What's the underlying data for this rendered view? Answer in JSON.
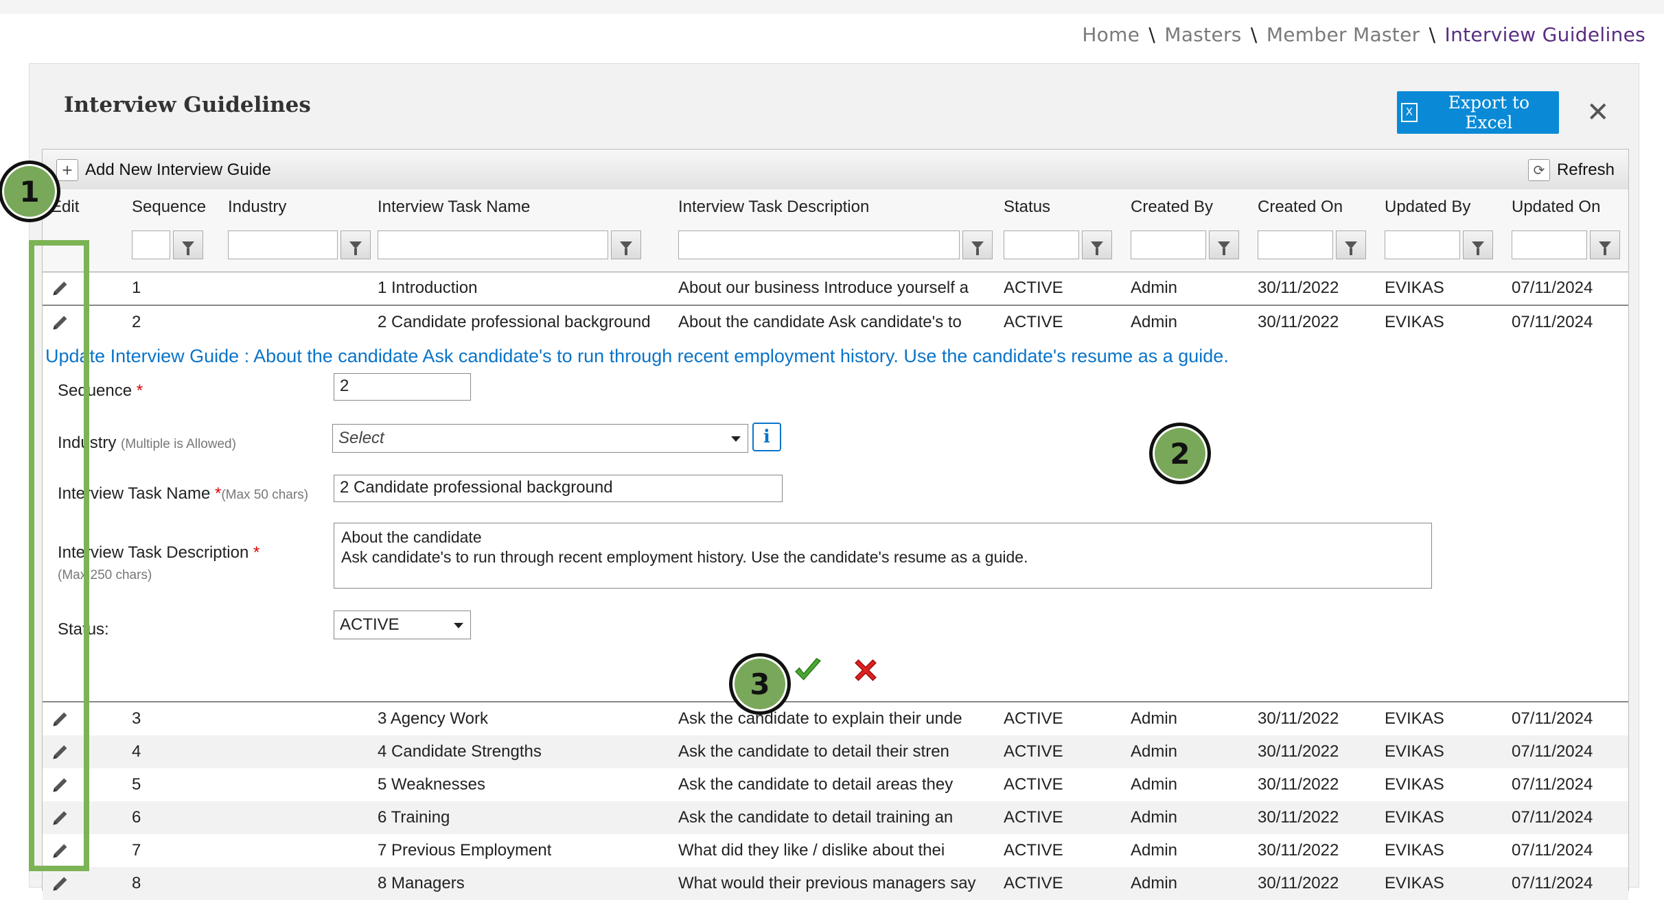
{
  "breadcrumb": {
    "home": "Home",
    "masters": "Masters",
    "member_master": "Member Master",
    "current": "Interview Guidelines",
    "separator": "\\"
  },
  "panel": {
    "title": "Interview Guidelines",
    "export_label": "Export to Excel",
    "close_icon": "close-icon"
  },
  "toolbar": {
    "add_label": "Add New Interview Guide",
    "refresh_label": "Refresh"
  },
  "columns": [
    "Edit",
    "Sequence",
    "Industry",
    "Interview Task Name",
    "Interview Task Description",
    "Status",
    "Created By",
    "Created On",
    "Updated By",
    "Updated On"
  ],
  "rows_top": [
    {
      "seq": "1",
      "industry": "",
      "name": "1 Introduction",
      "desc": "About our business Introduce yourself a",
      "status": "ACTIVE",
      "created_by": "Admin",
      "created_on": "30/11/2022",
      "updated_by": "EVIKAS",
      "updated_on": "07/11/2024"
    },
    {
      "seq": "2",
      "industry": "",
      "name": "2 Candidate professional background",
      "desc": "About the candidate Ask candidate's to",
      "status": "ACTIVE",
      "created_by": "Admin",
      "created_on": "30/11/2022",
      "updated_by": "EVIKAS",
      "updated_on": "07/11/2024"
    }
  ],
  "form": {
    "title": "Update Interview Guide : About the candidate Ask candidate's to run through recent employment history. Use the candidate's resume as a guide.",
    "sequence_label": "Sequence",
    "sequence_value": "2",
    "industry_label": "Industry",
    "industry_hint": "(Multiple is Allowed)",
    "industry_placeholder": "Select",
    "task_name_label": "Interview Task Name",
    "task_name_hint": "(Max 50 chars)",
    "task_name_value": "2 Candidate professional background",
    "task_desc_label": "Interview Task Description",
    "task_desc_hint": "(Max 250 chars)",
    "task_desc_line1": "About the candidate",
    "task_desc_line2": "Ask candidate's to run through recent employment history.  Use the candidate's resume as a guide.",
    "status_label": "Status:",
    "status_value": "ACTIVE",
    "required_mark": "*"
  },
  "rows_bottom": [
    {
      "seq": "3",
      "industry": "",
      "name": "3 Agency Work",
      "desc": "Ask the candidate to explain their unde",
      "status": "ACTIVE",
      "created_by": "Admin",
      "created_on": "30/11/2022",
      "updated_by": "EVIKAS",
      "updated_on": "07/11/2024"
    },
    {
      "seq": "4",
      "industry": "",
      "name": "4 Candidate Strengths",
      "desc": "Ask the candidate to detail their stren",
      "status": "ACTIVE",
      "created_by": "Admin",
      "created_on": "30/11/2022",
      "updated_by": "EVIKAS",
      "updated_on": "07/11/2024"
    },
    {
      "seq": "5",
      "industry": "",
      "name": "5 Weaknesses",
      "desc": "Ask the candidate to detail areas they",
      "status": "ACTIVE",
      "created_by": "Admin",
      "created_on": "30/11/2022",
      "updated_by": "EVIKAS",
      "updated_on": "07/11/2024"
    },
    {
      "seq": "6",
      "industry": "",
      "name": "6 Training",
      "desc": "Ask the candidate to detail training an",
      "status": "ACTIVE",
      "created_by": "Admin",
      "created_on": "30/11/2022",
      "updated_by": "EVIKAS",
      "updated_on": "07/11/2024"
    },
    {
      "seq": "7",
      "industry": "",
      "name": "7 Previous Employment",
      "desc": "What did they like / dislike about thei",
      "status": "ACTIVE",
      "created_by": "Admin",
      "created_on": "30/11/2022",
      "updated_by": "EVIKAS",
      "updated_on": "07/11/2024"
    },
    {
      "seq": "8",
      "industry": "",
      "name": "8 Managers",
      "desc": "What would their previous managers say",
      "status": "ACTIVE",
      "created_by": "Admin",
      "created_on": "30/11/2022",
      "updated_by": "EVIKAS",
      "updated_on": "07/11/2024"
    }
  ],
  "markers": [
    "1",
    "2",
    "3"
  ],
  "colors": {
    "accent_blue": "#0a8ad6",
    "breadcrumb_current": "#5a2d82",
    "marker_green": "#79a85a",
    "highlight_green": "#7cb355"
  }
}
